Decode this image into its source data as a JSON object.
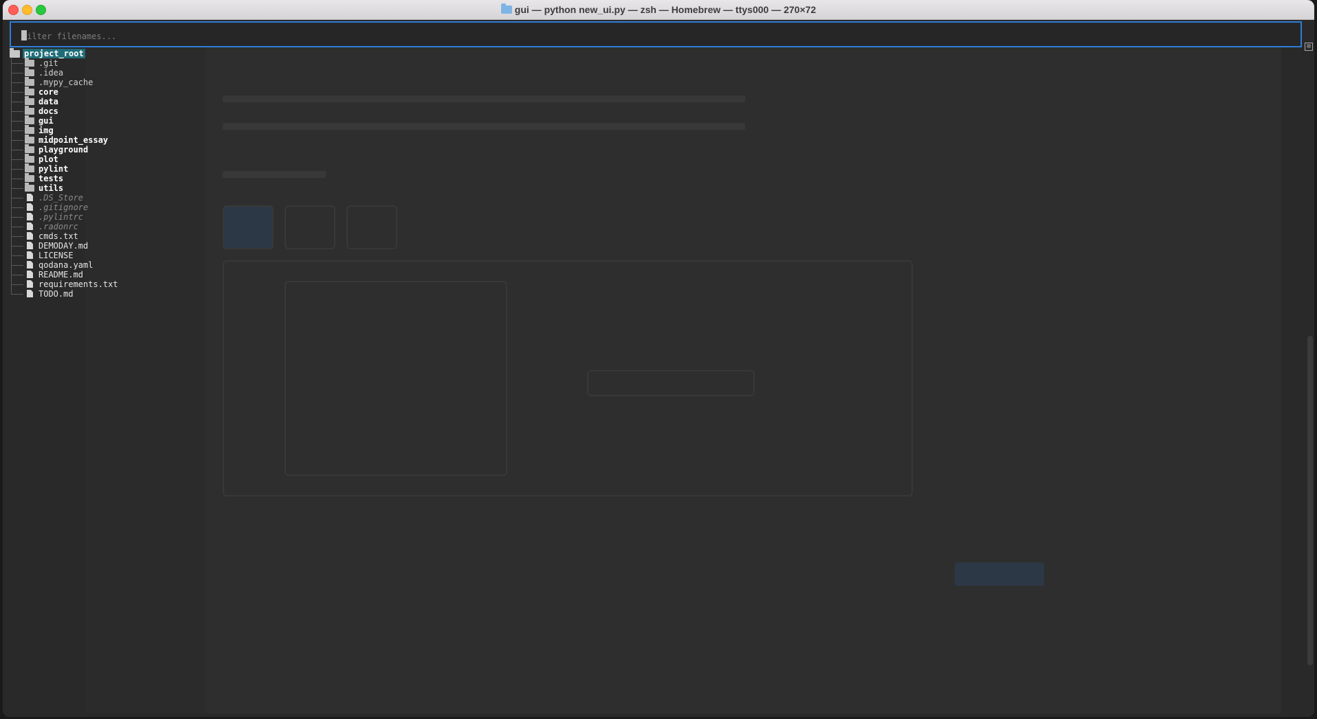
{
  "window": {
    "title": "gui — python new_ui.py — zsh — Homebrew — ttys000 — 270×72"
  },
  "filter": {
    "placeholder": "Filter filenames..."
  },
  "tree": {
    "root": "project_root",
    "items": [
      {
        "name": ".git",
        "kind": "hidden-dir"
      },
      {
        "name": ".idea",
        "kind": "hidden-dir"
      },
      {
        "name": ".mypy_cache",
        "kind": "hidden-dir"
      },
      {
        "name": "core",
        "kind": "dir"
      },
      {
        "name": "data",
        "kind": "dir"
      },
      {
        "name": "docs",
        "kind": "dir"
      },
      {
        "name": "gui",
        "kind": "dir"
      },
      {
        "name": "img",
        "kind": "dir"
      },
      {
        "name": "midpoint_essay",
        "kind": "dir"
      },
      {
        "name": "playground",
        "kind": "dir"
      },
      {
        "name": "plot",
        "kind": "dir"
      },
      {
        "name": "pylint",
        "kind": "dir"
      },
      {
        "name": "tests",
        "kind": "dir"
      },
      {
        "name": "utils",
        "kind": "dir"
      },
      {
        "name": ".DS_Store",
        "kind": "hidden-file"
      },
      {
        "name": ".gitignore",
        "kind": "hidden-file"
      },
      {
        "name": ".pylintrc",
        "kind": "hidden-file"
      },
      {
        "name": ".radonrc",
        "kind": "hidden-file"
      },
      {
        "name": "cmds.txt",
        "kind": "file"
      },
      {
        "name": "DEMODAY.md",
        "kind": "file"
      },
      {
        "name": "LICENSE",
        "kind": "file"
      },
      {
        "name": "qodana.yaml",
        "kind": "file"
      },
      {
        "name": "README.md",
        "kind": "file"
      },
      {
        "name": "requirements.txt",
        "kind": "file"
      },
      {
        "name": "TODO.md",
        "kind": "file"
      }
    ]
  },
  "colors": {
    "filter_border": "#2e7ed6",
    "root_highlight": "#1f6d78"
  }
}
